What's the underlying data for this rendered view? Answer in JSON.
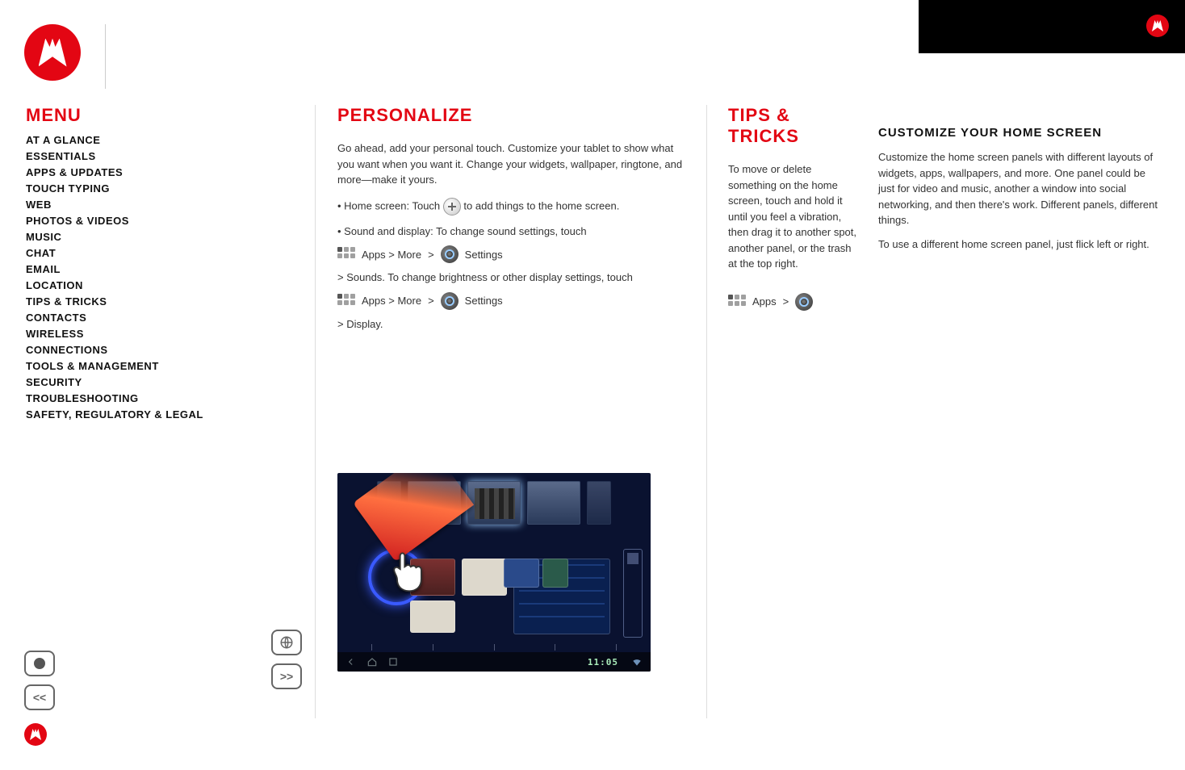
{
  "header": {
    "brand": "Motorola"
  },
  "menu": {
    "title": "MENU",
    "items": [
      "AT A GLANCE",
      "ESSENTIALS",
      "APPS & UPDATES",
      "TOUCH TYPING",
      "WEB",
      "PHOTOS & VIDEOS",
      "MUSIC",
      "CHAT",
      "EMAIL",
      "LOCATION",
      "TIPS & TRICKS",
      "CONTACTS",
      "WIRELESS",
      "CONNECTIONS",
      "TOOLS & MANAGEMENT",
      "SECURITY",
      "TROUBLESHOOTING",
      "SAFETY, REGULATORY & LEGAL"
    ]
  },
  "personalize": {
    "title": "PERSONALIZE",
    "para1": "Go ahead, add your personal touch. Customize your tablet to show what you want when you want it. Change your widgets, wallpaper, ringtone, and more—make it yours.",
    "homelead": "• Home screen: Touch",
    "homecont": "to add things to the home screen.",
    "label_apps_more": "Apps > More",
    "label_settings": "Settings",
    "sound_display": "• Sound and display: To change sound settings, touch",
    "sounds": "> Sounds. To change brightness or other display settings, touch",
    "display": "> Display."
  },
  "tips": {
    "title": "TIPS & TRICKS",
    "body": "To move or delete something on the home screen, touch and hold it until you feel a vibration, then drag it to another spot, another panel, or the trash at the top right.",
    "apps_short": "Apps"
  },
  "right_col": {
    "title": "CUSTOMIZE YOUR HOME SCREEN",
    "body": "Customize the home screen panels with different layouts of widgets, apps, wallpapers, and more. One panel could be just for video and music, another a window into social networking, and then there's work. Different panels, different things.",
    "body2": "To use a different home screen panel, just flick left or right."
  },
  "tablet": {
    "time": "11:05",
    "nav_back": "Back",
    "nav_home": "Home",
    "nav_recent": "Recent"
  },
  "footer": {
    "prev": "<<",
    "next": ">>"
  },
  "colors": {
    "accent": "#e30613",
    "ink": "#111"
  }
}
